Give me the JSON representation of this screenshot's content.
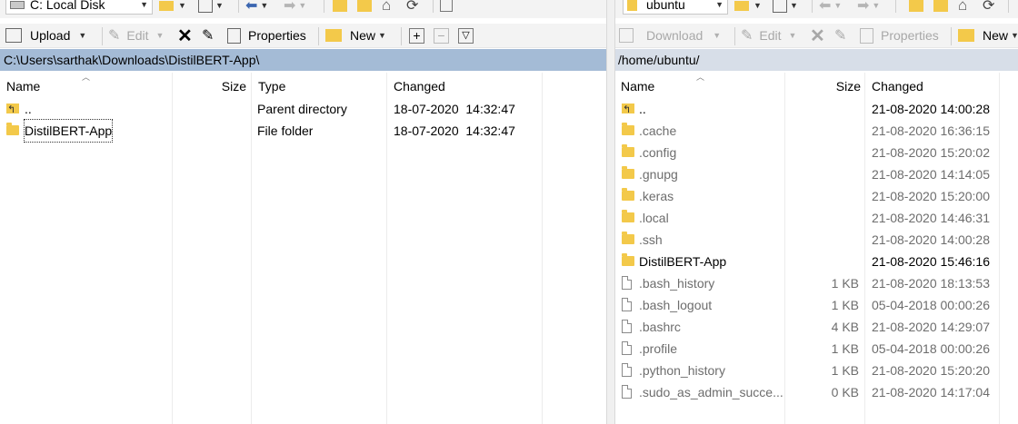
{
  "left": {
    "drive": "C: Local Disk",
    "toolbar": {
      "upload": "Upload",
      "edit": "Edit",
      "properties": "Properties",
      "new": "New"
    },
    "path": "C:\\Users\\sarthak\\Downloads\\DistilBERT-App\\",
    "columns": {
      "name": "Name",
      "size": "Size",
      "type": "Type",
      "changed": "Changed"
    },
    "rows": [
      {
        "name": "..",
        "type": "Parent directory",
        "changed": "18-07-2020  14:32:47",
        "icon": "parent-dir-icon"
      },
      {
        "name": "DistilBERT-App",
        "type": "File folder",
        "changed": "18-07-2020  14:32:47",
        "icon": "folder-icon"
      }
    ]
  },
  "right": {
    "drive": "ubuntu",
    "toolbar": {
      "download": "Download",
      "edit": "Edit",
      "properties": "Properties",
      "new": "New"
    },
    "path": "/home/ubuntu/",
    "columns": {
      "name": "Name",
      "size": "Size",
      "changed": "Changed"
    },
    "rows": [
      {
        "name": "..",
        "size": "",
        "changed": "21-08-2020 14:00:28",
        "icon": "parent-dir-icon"
      },
      {
        "name": ".cache",
        "size": "",
        "changed": "21-08-2020 16:36:15",
        "icon": "folder-icon"
      },
      {
        "name": ".config",
        "size": "",
        "changed": "21-08-2020 15:20:02",
        "icon": "folder-icon"
      },
      {
        "name": ".gnupg",
        "size": "",
        "changed": "21-08-2020 14:14:05",
        "icon": "folder-icon"
      },
      {
        "name": ".keras",
        "size": "",
        "changed": "21-08-2020 15:20:00",
        "icon": "folder-icon"
      },
      {
        "name": ".local",
        "size": "",
        "changed": "21-08-2020 14:46:31",
        "icon": "folder-icon"
      },
      {
        "name": ".ssh",
        "size": "",
        "changed": "21-08-2020 14:00:28",
        "icon": "folder-icon"
      },
      {
        "name": "DistilBERT-App",
        "size": "",
        "changed": "21-08-2020 15:46:16",
        "icon": "folder-icon"
      },
      {
        "name": ".bash_history",
        "size": "1 KB",
        "changed": "21-08-2020 18:13:53",
        "icon": "file-icon"
      },
      {
        "name": ".bash_logout",
        "size": "1 KB",
        "changed": "05-04-2018 00:00:26",
        "icon": "file-icon"
      },
      {
        "name": ".bashrc",
        "size": "4 KB",
        "changed": "21-08-2020 14:29:07",
        "icon": "file-icon"
      },
      {
        "name": ".profile",
        "size": "1 KB",
        "changed": "05-04-2018 00:00:26",
        "icon": "file-icon"
      },
      {
        "name": ".python_history",
        "size": "1 KB",
        "changed": "21-08-2020 15:20:20",
        "icon": "file-icon"
      },
      {
        "name": ".sudo_as_admin_succe...",
        "size": "0 KB",
        "changed": "21-08-2020 14:17:04",
        "icon": "file-icon"
      }
    ]
  },
  "colors": {
    "left_path_bg": "#a4bbd6",
    "right_path_bg": "#d7dee8",
    "folder": "#f3c94a"
  }
}
